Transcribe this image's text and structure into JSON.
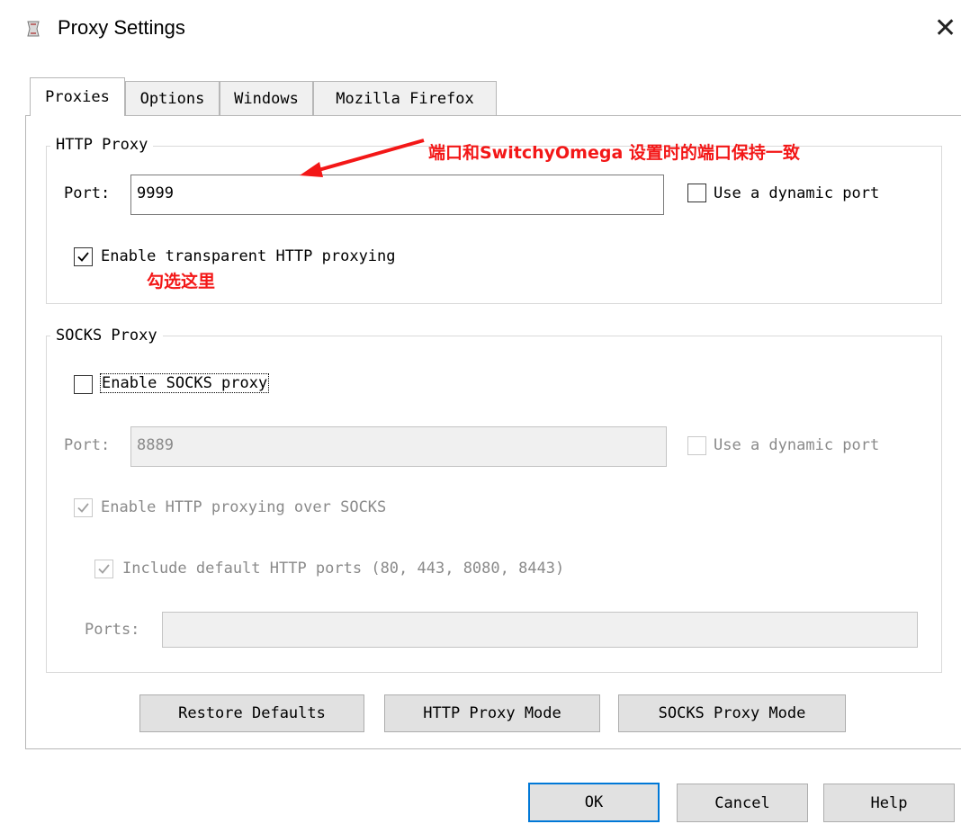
{
  "window": {
    "title": "Proxy Settings",
    "app_icon": "proxy-app-icon",
    "close_icon": "close-icon",
    "close_glyph": "✕"
  },
  "tabs": [
    {
      "label": "Proxies",
      "active": true
    },
    {
      "label": "Options",
      "active": false
    },
    {
      "label": "Windows",
      "active": false
    },
    {
      "label": "Mozilla Firefox",
      "active": false
    }
  ],
  "http_proxy": {
    "group_label": "HTTP Proxy",
    "port_label": "Port:",
    "port_value": "9999",
    "dynamic_port_label": "Use a dynamic port",
    "dynamic_port_checked": false,
    "transparent_label": "Enable transparent HTTP proxying",
    "transparent_checked": true
  },
  "socks_proxy": {
    "group_label": "SOCKS Proxy",
    "enable_label": "Enable SOCKS proxy",
    "enable_checked": false,
    "port_label": "Port:",
    "port_value": "8889",
    "dynamic_port_label": "Use a dynamic port",
    "http_over_socks_label": "Enable HTTP proxying over SOCKS",
    "http_over_socks_checked": true,
    "include_ports_label": "Include default HTTP ports (80, 443, 8080, 8443)",
    "include_ports_checked": true,
    "ports_label": "Ports:",
    "ports_value": ""
  },
  "panel_buttons": {
    "restore": "Restore Defaults",
    "http_mode": "HTTP Proxy Mode",
    "socks_mode": "SOCKS Proxy Mode"
  },
  "dialog_buttons": {
    "ok": "OK",
    "cancel": "Cancel",
    "help": "Help"
  },
  "annotations": {
    "port_note": "端口和SwitchyOmega 设置时的端口保持一致",
    "check_note": "勾选这里",
    "color": "#f31717"
  }
}
